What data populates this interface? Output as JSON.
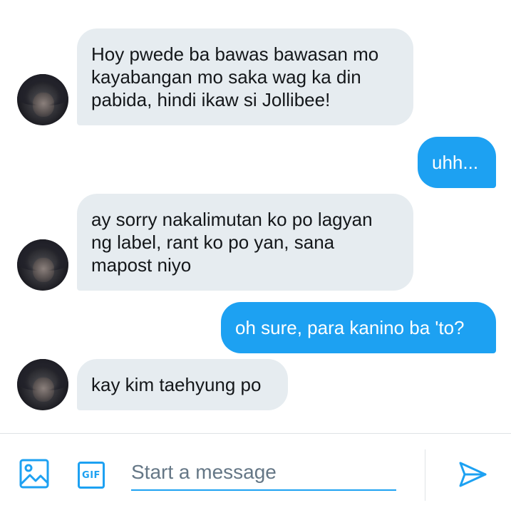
{
  "messages": [
    {
      "direction": "received",
      "text": "Hoy pwede ba bawas bawasan mo\nkayabangan mo saka wag ka din\npabida, hindi ikaw si Jollibee!"
    },
    {
      "direction": "sent",
      "text": "uhh..."
    },
    {
      "direction": "received",
      "text": "ay sorry nakalimutan ko po lagyan\nng label, rant ko po yan, sana\nmapost niyo"
    },
    {
      "direction": "sent",
      "text": "oh sure, para kanino ba 'to?"
    },
    {
      "direction": "received",
      "text": "kay kim taehyung po"
    }
  ],
  "composer": {
    "placeholder": "Start a message",
    "value": "",
    "gif_label": "GIF",
    "icons": {
      "media": "image-icon",
      "gif": "gif-icon",
      "send": "send-icon"
    }
  },
  "colors": {
    "accent": "#1da1f2",
    "received_bubble": "#e6ecf0",
    "text": "#14171a",
    "placeholder": "#657786"
  }
}
